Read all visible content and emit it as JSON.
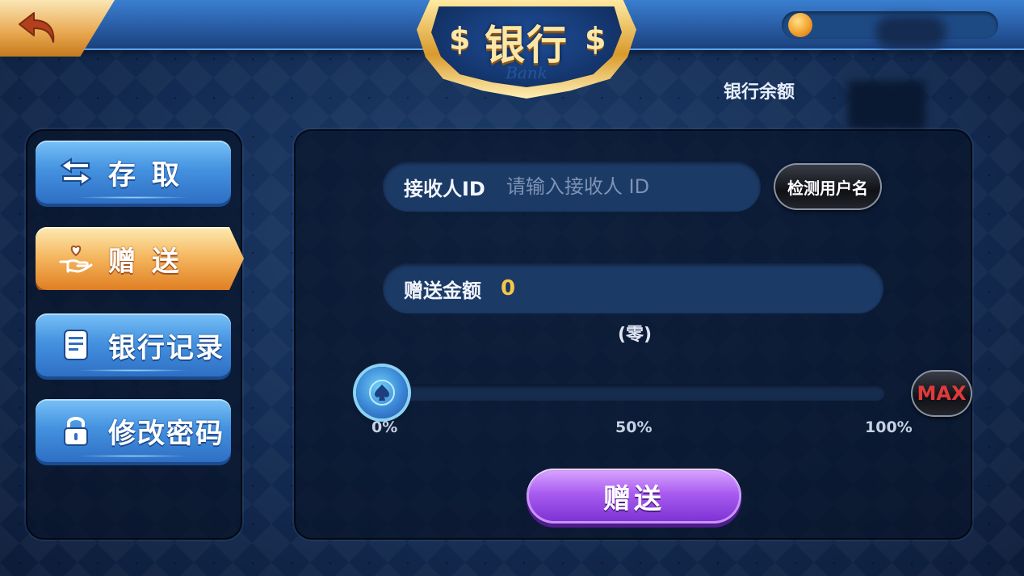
{
  "header": {
    "title": "银行",
    "subtitle": "Bank",
    "bank_balance_label": "银行余额"
  },
  "sidebar": {
    "items": [
      {
        "label": "存 取",
        "icon": "deposit-withdraw-arrows-icon",
        "active": false
      },
      {
        "label": "赠 送",
        "icon": "gift-hand-heart-icon",
        "active": true
      },
      {
        "label": "银行记录",
        "icon": "document-icon",
        "active": false
      },
      {
        "label": "修改密码",
        "icon": "lock-icon",
        "active": false
      }
    ]
  },
  "form": {
    "recipient_label": "接收人ID",
    "recipient_placeholder": "请输入接收人 ID",
    "check_username_label": "检测用户名",
    "amount_label": "赠送金额",
    "amount_value": "0",
    "amount_in_words": "(零)"
  },
  "slider": {
    "value": 0,
    "ticks": [
      "0%",
      "50%",
      "100%"
    ],
    "max_label": "MAX"
  },
  "submit_label": "赠送",
  "colors": {
    "accent_gold": "#f5c748",
    "active_tab": "#f4b45c",
    "tab_blue": "#4592e0",
    "submit_purple": "#a95cf0",
    "max_red": "#e03a3a"
  }
}
